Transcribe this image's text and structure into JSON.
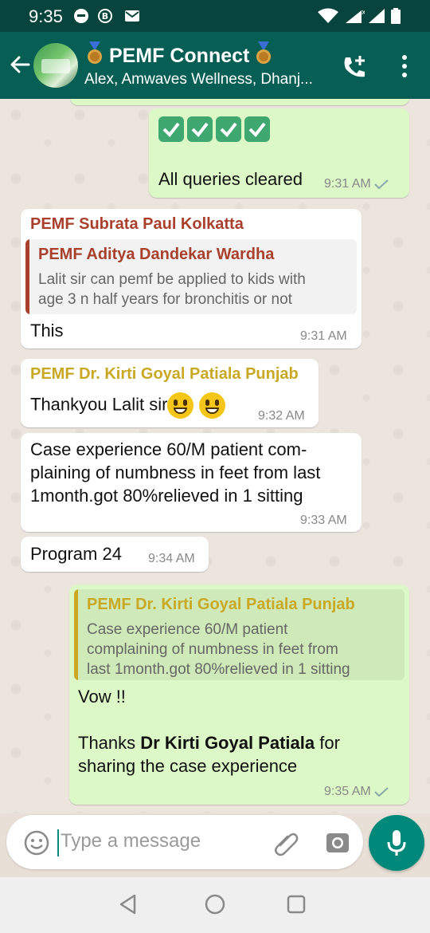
{
  "status_bar": {
    "time": "9:35"
  },
  "header": {
    "title": "PEMF Connect",
    "subtitle": "Alex, Amwaves Wellness, Dhanj..."
  },
  "messages": {
    "m1": {
      "text": "All queries cleared",
      "time": "9:31 AM"
    },
    "m2": {
      "sender": "PEMF Subrata Paul Kolkatta",
      "quote_sender": "PEMF Aditya Dandekar Wardha",
      "quote_line1": "Lalit sir can pemf be applied to kids with",
      "quote_line2": "age 3 n half years for bronchitis or not",
      "text": "This",
      "time": "9:31 AM"
    },
    "m3": {
      "sender": "PEMF Dr. Kirti Goyal Patiala Punjab",
      "text": "Thankyou Lalit sir",
      "time": "9:32 AM"
    },
    "m4": {
      "line1": "Case experience 60/M patient com-",
      "line2": "plaining of numbness in feet from last",
      "line3": "1month.got  80%relieved in 1 sitting",
      "time": "9:33 AM"
    },
    "m5": {
      "text": "Program 24",
      "time": "9:34 AM"
    },
    "m6": {
      "quote_sender": "PEMF Dr. Kirti Goyal Patiala Punjab",
      "quote_line1": "Case experience 60/M patient",
      "quote_line2": "complaining of numbness in feet from",
      "quote_line3": "last 1month.got  80%relieved in 1 sitting",
      "line1": "Vow !!",
      "line2_pre": "Thanks ",
      "line2_bold": "Dr Kirti Goyal Patiala",
      "line2_post": " for",
      "line3": "sharing the case experience",
      "time": "9:35 AM"
    }
  },
  "composer": {
    "placeholder": "Type a message"
  },
  "colors": {
    "header": "#075e54",
    "incoming": "#ffffff",
    "outgoing": "#dcf8c6",
    "sender_red": "#a8402c",
    "sender_yellow": "#c9a824",
    "mic": "#00897b"
  },
  "icons": [
    "back-arrow-icon",
    "add-call-icon",
    "more-options-icon",
    "emoji-icon",
    "attach-icon",
    "camera-icon",
    "mic-icon",
    "nav-back-icon",
    "nav-home-icon",
    "nav-recents-icon"
  ]
}
